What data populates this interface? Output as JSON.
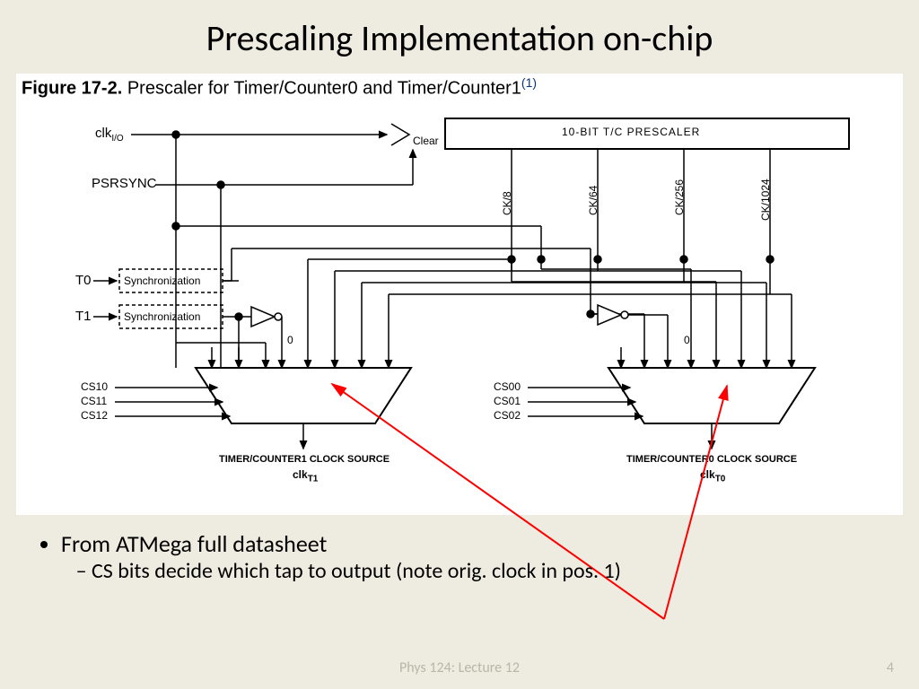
{
  "title": "Prescaling Implementation on-chip",
  "figure": {
    "label_bold": "Figure 17-2.",
    "label_rest": "Prescaler for Timer/Counter0 and Timer/Counter1",
    "sup": "(1)"
  },
  "signals": {
    "clkio": "clk",
    "clkio_sub": "I/O",
    "psrsync": "PSRSYNC",
    "t0": "T0",
    "t1": "T1",
    "sync": "Synchronization",
    "prescaler": "10-BIT T/C PRESCALER",
    "clear": "Clear",
    "taps": [
      "CK/8",
      "CK/64",
      "CK/256",
      "CK/1024"
    ],
    "zero": "0",
    "cs1": [
      "CS10",
      "CS11",
      "CS12"
    ],
    "cs0": [
      "CS00",
      "CS01",
      "CS02"
    ],
    "out1": "TIMER/COUNTER1 CLOCK SOURCE",
    "out0": "TIMER/COUNTER0 CLOCK SOURCE",
    "clkt1": "clk",
    "clkt1_sub": "T1",
    "clkt0": "clk",
    "clkt0_sub": "T0"
  },
  "bullets": {
    "b1": "From ATMega full datasheet",
    "b1a": "CS bits decide which tap to output (note orig. clock in pos. 1)"
  },
  "footer": {
    "center": "Phys 124: Lecture 12",
    "page": "4"
  }
}
